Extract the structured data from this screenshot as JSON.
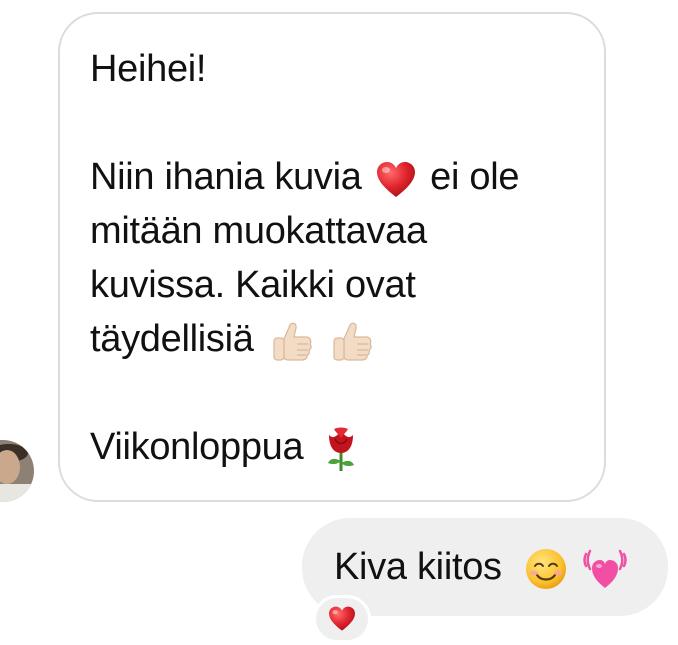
{
  "incoming_message": {
    "lines": [
      {
        "text": "Heihei!",
        "emoji": ""
      },
      {
        "text": "",
        "emoji": ""
      },
      {
        "text": "Niin ihania kuvia ",
        "emoji": "red-heart",
        "after": " ei ole"
      },
      {
        "text": "mitään muokattavaa",
        "emoji": ""
      },
      {
        "text": "kuvissa. Kaikki ovat",
        "emoji": ""
      },
      {
        "text": "täydellisiä ",
        "emoji": "thumbs-up-light-skin-x2"
      },
      {
        "text": "",
        "emoji": ""
      },
      {
        "text": "Viikonloppua ",
        "emoji": "rose"
      }
    ],
    "line1": "Heihei!",
    "line3_before": "Niin ihania kuvia",
    "line3_after": "ei ole",
    "line4": "mitään muokattavaa",
    "line5": "kuvissa. Kaikki ovat",
    "line6": "täydellisiä",
    "line8": "Viikonloppua"
  },
  "outgoing_message": {
    "text": "Kiva kiitos",
    "emojis": [
      "smiling-face-icon",
      "beating-pink-heart-icon"
    ]
  },
  "reaction": {
    "emoji": "red-heart-icon"
  },
  "colors": {
    "incoming_border": "#dcdcdc",
    "outgoing_background": "#efefef",
    "text": "#111111",
    "heart_red": "#e0252e",
    "heart_pink": "#f14fa4",
    "rose_red": "#c3141e"
  }
}
